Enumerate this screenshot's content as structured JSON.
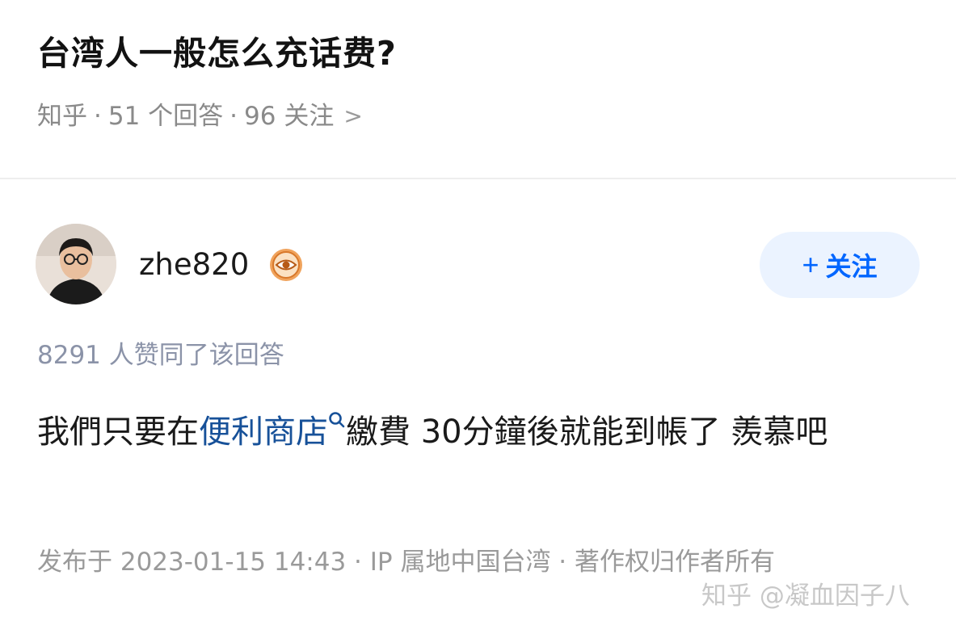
{
  "question": {
    "title": "台湾人一般怎么充话费?",
    "source": "知乎",
    "answers": "51 个回答",
    "followers": "96 关注",
    "chevron": ">"
  },
  "author": {
    "name": "zhe820",
    "badge_icon": "eye-badge-icon",
    "follow_plus": "+",
    "follow_label": "关注"
  },
  "answer": {
    "upvotes": "8291 人赞同了该回答",
    "text_before": "我們只要在",
    "link": "便利商店",
    "text_after": "繳費 30分鐘後就能到帳了 羨慕吧",
    "footer": "发布于 2023-01-15 14:43 · IP 属地中国台湾 · 著作权归作者所有"
  },
  "watermark": "知乎 @凝血因子八",
  "colors": {
    "accent": "#0066ff",
    "follow_bg": "#ebf3ff",
    "link": "#175199",
    "meta": "#8a8a8a",
    "upvotes": "#8b93a8"
  }
}
